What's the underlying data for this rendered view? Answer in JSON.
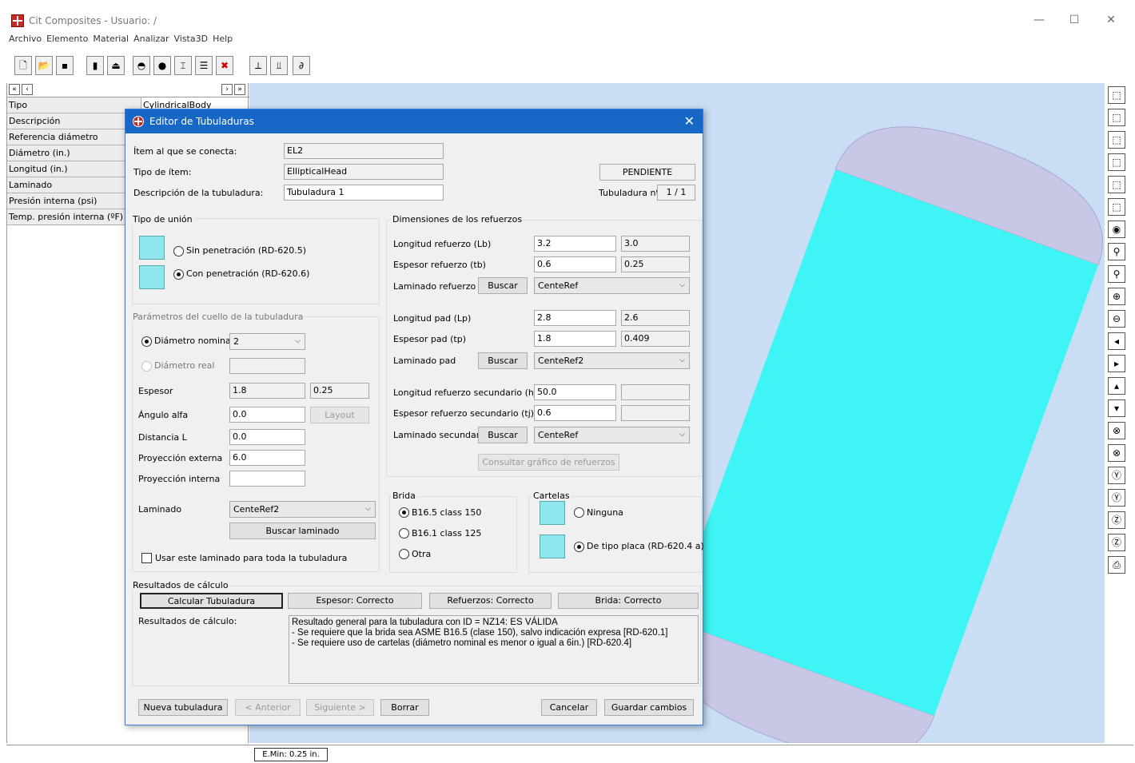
{
  "app": {
    "title": "Cit Composites  -  Usuario: /"
  },
  "menu": [
    "Archivo",
    "Elemento",
    "Material",
    "Analizar",
    "Vista3D",
    "Help"
  ],
  "left_panel": {
    "nav": [
      "«",
      "‹",
      "›",
      "»"
    ],
    "rows": [
      {
        "label": "Tipo",
        "value": "CylindricalBody"
      },
      {
        "label": "Descripción",
        "value": ""
      },
      {
        "label": "Referencia diámetro",
        "value": ""
      },
      {
        "label": "Diámetro (in.)",
        "value": ""
      },
      {
        "label": "Longitud (in.)",
        "value": ""
      },
      {
        "label": "Laminado",
        "value": ""
      },
      {
        "label": "Presión interna (psi)",
        "value": ""
      },
      {
        "label": "Temp. presión interna (ºF)",
        "value": ""
      }
    ]
  },
  "status": {
    "emin": "E.Min: 0.25 in."
  },
  "dialog": {
    "title": "Editor de Tubuladuras",
    "item_conecta_label": "Ítem al que se conecta:",
    "item_conecta_value": "EL2",
    "tipo_item_label": "Tipo de ítem:",
    "tipo_item_value": "EllipticalHead",
    "descripcion_label": "Descripción de la tubuladura:",
    "descripcion_value": "Tubuladura 1",
    "pendiente_label": "PENDIENTE",
    "tubuladura_n_label": "Tubuladura nº",
    "tubuladura_n_value": "1 / 1",
    "tipo_union": {
      "title": "Tipo de unión",
      "opt1": "Sin penetración (RD-620.5)",
      "opt2": "Con penetración (RD-620.6)",
      "selected": "Con penetración (RD-620.6)"
    },
    "cuello": {
      "title": "Parámetros del cuello de la tubuladura",
      "diametro_nominal_label": "Diámetro nominal",
      "diametro_nominal_value": "2",
      "diametro_real_label": "Diámetro real",
      "espesor_label": "Espesor",
      "espesor_v1": "1.8",
      "espesor_v2": "0.25",
      "angulo_label": "Ángulo alfa",
      "angulo_value": "0.0",
      "layout_label": "Layout",
      "distancia_label": "Distancia L",
      "distancia_value": "0.0",
      "proy_ext_label": "Proyección externa",
      "proy_ext_value": "6.0",
      "proy_int_label": "Proyección interna",
      "proy_int_value": "",
      "laminado_label": "Laminado",
      "laminado_value": "CenteRef2",
      "buscar_laminado_label": "Buscar laminado",
      "usar_label": "Usar este laminado para toda la tubuladura"
    },
    "refuerzos": {
      "title": "Dimensiones de los refuerzos",
      "lb_label": "Longitud refuerzo (Lb)",
      "lb_v1": "3.2",
      "lb_v2": "3.0",
      "tb_label": "Espesor refuerzo (tb)",
      "tb_v1": "0.6",
      "tb_v2": "0.25",
      "lam_ref_label": "Laminado refuerzo",
      "lam_ref_value": "CenteRef",
      "lp_label": "Longitud pad (Lp)",
      "lp_v1": "2.8",
      "lp_v2": "2.6",
      "tp_label": "Espesor pad (tp)",
      "tp_v1": "1.8",
      "tp_v2": "0.409",
      "lam_pad_label": "Laminado pad",
      "lam_pad_value": "CenteRef2",
      "hj_label": "Longitud refuerzo secundario (hj)",
      "hj_v1": "50.0",
      "hj_v2": "",
      "tj_label": "Espesor refuerzo secundario (tj)",
      "tj_v1": "0.6",
      "tj_v2": "",
      "lam_sec_label": "Laminado secundario",
      "lam_sec_value": "CenteRef",
      "buscar_label": "Buscar",
      "consultar_label": "Consultar gráfico de refuerzos"
    },
    "brida": {
      "title": "Brida",
      "opts": [
        "B16.5 class 150",
        "B16.1 class 125",
        "Otra"
      ],
      "selected": "B16.5 class 150"
    },
    "cartelas": {
      "title": "Cartelas",
      "opt1": "Ninguna",
      "opt2": "De tipo placa (RD-620.4 a)",
      "selected": "De tipo placa (RD-620.4 a)"
    },
    "resultados": {
      "title": "Resultados de cálculo",
      "calcular_label": "Calcular Tubuladura",
      "espesor_status": "Espesor: Correcto",
      "refuerzos_status": "Refuerzos: Correcto",
      "brida_status": "Brida: Correcto",
      "text_label": "Resultados de cálculo:",
      "lines": [
        "Resultado general para la tubuladura con ID = NZ14: ES VÁLIDA",
        "- Se requiere que la brida sea ASME B16.5 (clase 150), salvo indicación expresa [RD-620.1]",
        "- Se requiere uso de cartelas (diámetro nominal es menor o igual a 6in.) [RD-620.4]"
      ]
    },
    "footer": {
      "nueva": "Nueva tubuladura",
      "anterior": "< Anterior",
      "siguiente": "Siguiente >",
      "borrar": "Borrar",
      "cancelar": "Cancelar",
      "guardar": "Guardar cambios"
    }
  },
  "colors": {
    "title_blue": "#1767c7",
    "viewport_bg": "#c9def5",
    "cylinder": "#3ef4f5",
    "head": "#c8c8e6"
  }
}
